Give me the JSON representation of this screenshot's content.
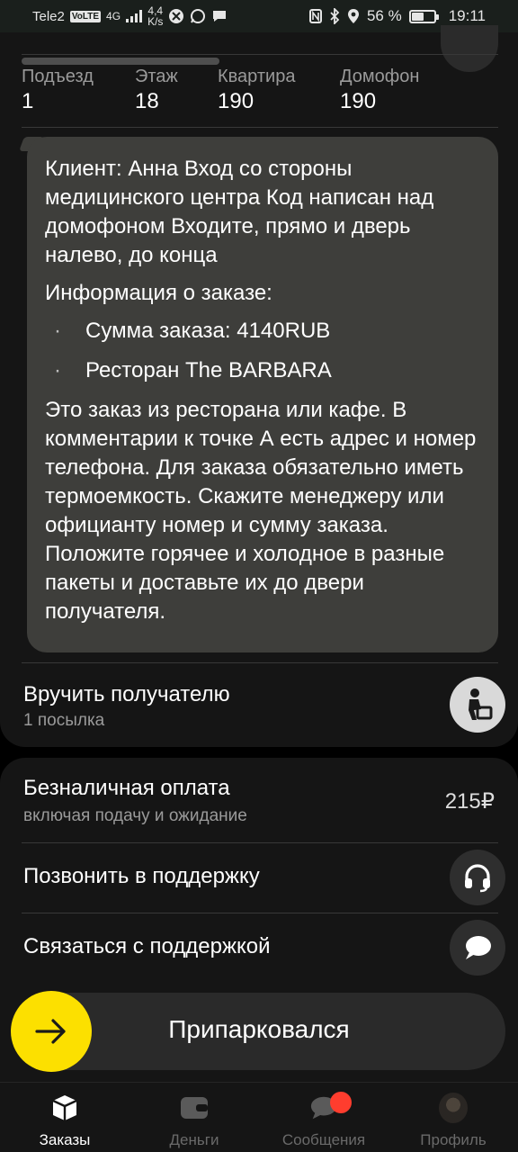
{
  "status_bar": {
    "carrier": "Tele2",
    "volte": "VoLTE",
    "network": "4G",
    "speed_value": "4,4",
    "speed_unit": "K/s",
    "battery": "56 %",
    "battery_level": 0.56,
    "time": "19:11"
  },
  "address": {
    "fields": [
      {
        "label": "Подъезд",
        "value": "1"
      },
      {
        "label": "Этаж",
        "value": "18"
      },
      {
        "label": "Квартира",
        "value": "190"
      },
      {
        "label": "Домофон",
        "value": "190"
      }
    ]
  },
  "comment": {
    "client_note": "Клиент: Анна Вход со стороны медицинского центра Код написан над домофоном  Входите, прямо и дверь налево, до конца",
    "info_header": "Информация о заказе:",
    "items": [
      "Сумма заказа: 4140RUB",
      "Ресторан The BARBARA"
    ],
    "instructions": "Это заказ из ресторана или кафе. В комментарии к точке А есть адрес и номер телефона. Для заказа обязательно иметь термоемкость. Скажите менеджеру или официанту номер и сумму заказа. Положите горячее и холодное в разные пакеты и доставьте их до двери получателя."
  },
  "delivery": {
    "title": "Вручить получателю",
    "subtitle": "1 посылка",
    "icon": "person-parcel-icon"
  },
  "payment": {
    "title": "Безналичная оплата",
    "subtitle": "включая подачу и ожидание",
    "amount": "215₽"
  },
  "support": {
    "call_label": "Позвонить в поддержку",
    "call_icon": "headset-icon",
    "chat_label": "Связаться с поддержкой",
    "chat_icon": "chat-bubble-icon"
  },
  "action": {
    "label": "Припарковался",
    "icon": "arrow-right-icon",
    "accent": "#fce000"
  },
  "nav": {
    "items": [
      {
        "label": "Заказы",
        "icon": "box-icon",
        "active": true
      },
      {
        "label": "Деньги",
        "icon": "wallet-icon",
        "active": false
      },
      {
        "label": "Сообщения",
        "icon": "messages-icon",
        "active": false,
        "badge_color": "#ff3d2e"
      },
      {
        "label": "Профиль",
        "icon": "avatar",
        "active": false
      }
    ]
  }
}
